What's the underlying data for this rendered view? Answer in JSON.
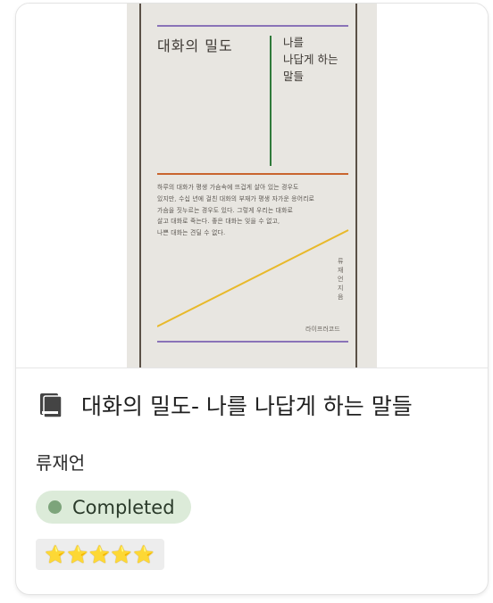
{
  "book": {
    "title": "대화의 밀도- 나를 나답게 하는 말들",
    "author": "류재언",
    "status": "Completed",
    "rating_stars": 5,
    "rating_display": "⭐⭐⭐⭐⭐",
    "icon": "book-icon"
  },
  "cover": {
    "title": "대화의 밀도",
    "subtitle": "나를\n나답게 하는\n말들",
    "body": "하루의 대화가 평생 가슴속에 뜨겁게 살아 있는 경우도\n있지만, 수십 년에 걸친 대화의 부재가 평생 자가운 응어리로\n가슴을 짓누르는 경우도 있다. 그렇게 우리는 대화로\n살고 대화로 죽는다. 좋은 대화는 잊을 수 없고,\n나쁜 대화는 견딜 수 없다.",
    "author_credit": "류재언 지음",
    "publisher": "라이프러코드"
  },
  "colors": {
    "status_badge_bg": "#dcebd9",
    "status_dot": "#7da47b",
    "cover_bg": "#e8e6e1",
    "cover_purple": "#8a73b8",
    "cover_orange": "#c9652e",
    "cover_green": "#2f7a3a",
    "cover_yellow": "#e8b92a"
  }
}
